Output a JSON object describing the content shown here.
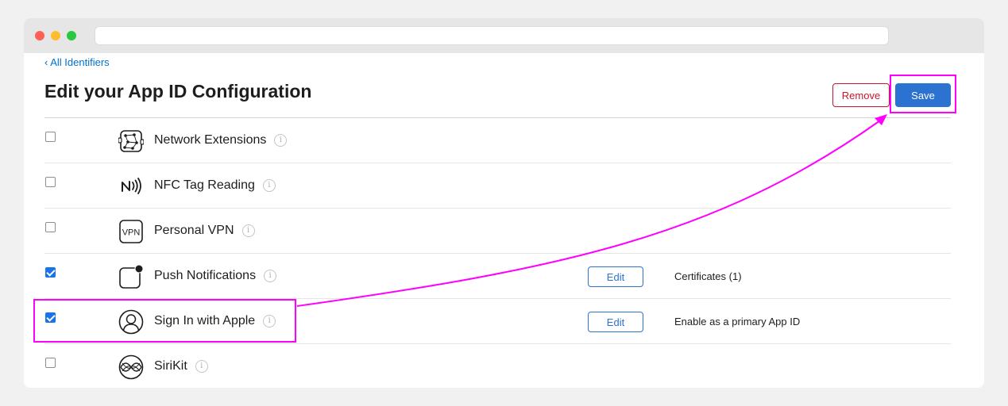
{
  "header": {
    "back_link": "‹ All Identifiers",
    "title": "Edit your App ID Configuration",
    "remove_label": "Remove",
    "save_label": "Save"
  },
  "capabilities": [
    {
      "name": "Network Extensions",
      "icon": "network-extensions-icon",
      "checked": false,
      "edit_label": "",
      "config": ""
    },
    {
      "name": "NFC Tag Reading",
      "icon": "nfc-icon",
      "checked": false,
      "edit_label": "",
      "config": ""
    },
    {
      "name": "Personal VPN",
      "icon": "vpn-icon",
      "vpn_text": "VPN",
      "checked": false,
      "edit_label": "",
      "config": ""
    },
    {
      "name": "Push Notifications",
      "icon": "push-notifications-icon",
      "checked": true,
      "edit_label": "Edit",
      "config": "Certificates (1)"
    },
    {
      "name": "Sign In with Apple",
      "icon": "person-icon",
      "checked": true,
      "edit_label": "Edit",
      "config": "Enable as a primary App ID"
    },
    {
      "name": "SiriKit",
      "icon": "siri-icon",
      "checked": false,
      "edit_label": "",
      "config": ""
    }
  ],
  "info_glyph": "i",
  "colors": {
    "accent": "#2c72d0",
    "remove": "#c9162b",
    "annotation": "#ff00ff"
  }
}
